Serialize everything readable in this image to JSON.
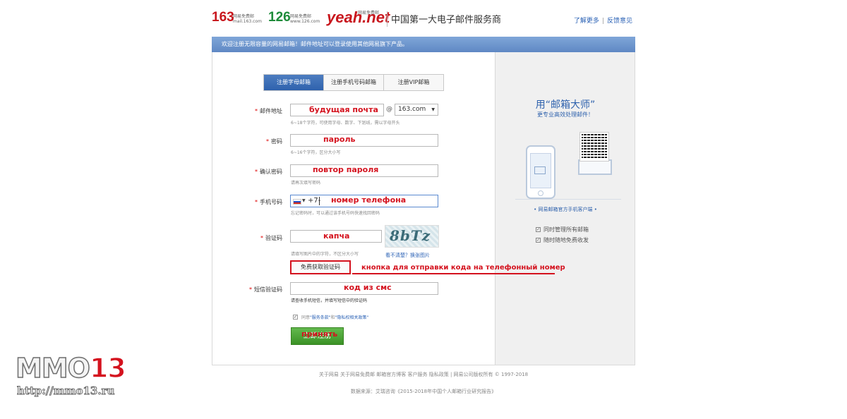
{
  "header": {
    "brand_163": "163",
    "brand_163_sub1": "网易免费邮",
    "brand_163_sub2": "mail.163.com",
    "brand_126": "126",
    "brand_126_sub1": "网易免费邮",
    "brand_126_sub2": "www.126.com",
    "brand_yeah": "yeah.net",
    "brand_yeah_sub": "网易免费邮",
    "slogan": "中国第一大电子邮件服务商",
    "learn_more": "了解更多",
    "feedback": "反馈意见",
    "sep": "|"
  },
  "banner": "欢迎注册无限容量的网易邮箱！邮件地址可以登录使用其他网易旗下产品。",
  "tabs": [
    {
      "label": "注册字母邮箱",
      "active": true
    },
    {
      "label": "注册手机号码邮箱",
      "active": false
    },
    {
      "label": "注册VIP邮箱",
      "active": false
    }
  ],
  "form": {
    "email": {
      "label": "邮件地址",
      "value": "будущая почта",
      "hint": "6~18个字符，可使用字母、数字、下划线，需以字母开头",
      "at": "@",
      "domain": "163.com"
    },
    "password": {
      "label": "密码",
      "value": "пароль",
      "hint": "6~16个字符，区分大小写"
    },
    "confirm": {
      "label": "确认密码",
      "value": "повтор пароля",
      "hint": "请再次填写密码"
    },
    "phone": {
      "label": "手机号码",
      "code": "+7-",
      "value": "номер телефона",
      "hint": "忘记密码时，可以通过该手机号码快速找回密码"
    },
    "captcha": {
      "label": "验证码",
      "value": "капча",
      "hint": "请填写图片中的字符，不区分大小写",
      "image_text": "8bTz",
      "refresh": "看不清楚？换张图片"
    },
    "sms_button": "免费获取验证码",
    "sms_note": "кнопка для отправки кода на телефонный номер",
    "sms": {
      "label": "短信验证码",
      "value": "код из смс",
      "hint": "请查收手机短信，并填写短信中的验证码"
    },
    "agree_prefix": "同意",
    "agree_terms": "\"服务条款\"",
    "agree_and": "和",
    "agree_privacy": "\"隐私权相关政策\"",
    "submit": "立即注册",
    "submit_over": "принять"
  },
  "promo": {
    "title": "用“邮箱大师”",
    "subtitle": "更专业高效处理邮件！",
    "client": "• 网易邮箱官方手机客户端 •",
    "features": [
      "同时管理所有邮箱",
      "随时随地免费收发"
    ]
  },
  "footer": {
    "line1": "关于网易  关于网易免费邮  邮箱官方博客  客户服务  隐私政策  |  网易公司版权所有 © 1997-2018",
    "line2": "数据来源：艾瑞咨询《2015-2018年中国个人邮箱行业研究报告》"
  },
  "watermark": {
    "logo_a": "MMO",
    "logo_b": "13",
    "url": "http://mmo13.ru"
  }
}
